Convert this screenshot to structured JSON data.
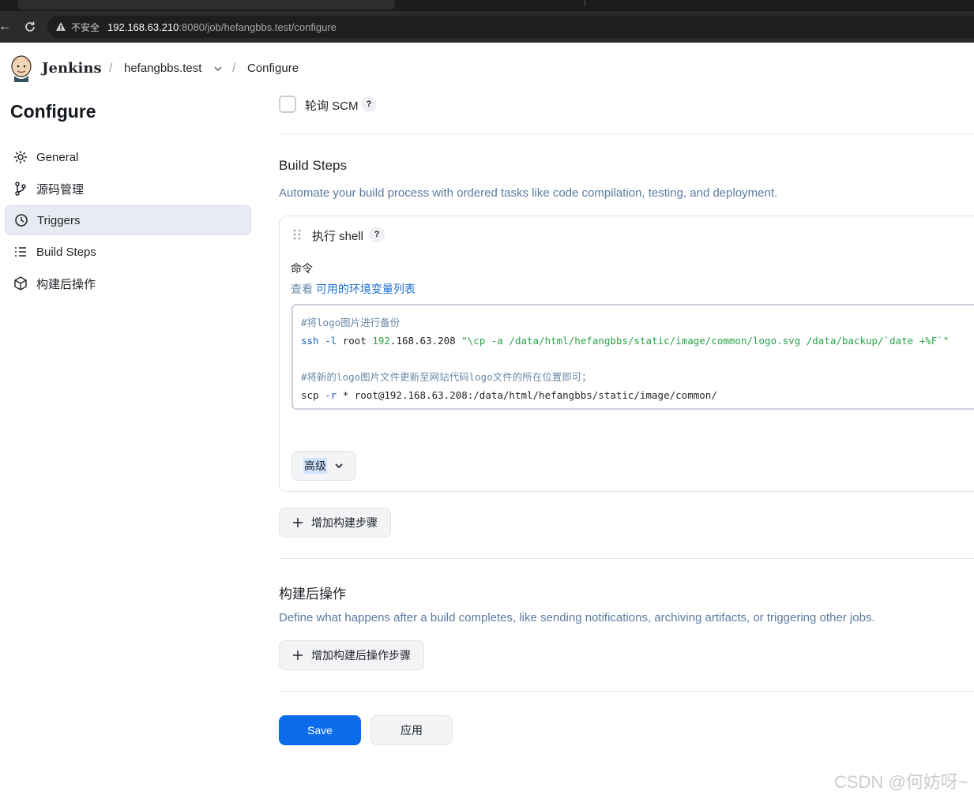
{
  "browser": {
    "insecure_label": "不安全",
    "url_host": "192.168.63.210",
    "url_path": ":8080/job/hefangbbs.test/configure"
  },
  "header": {
    "brand": "Jenkins",
    "breadcrumbs": [
      "hefangbbs.test",
      "Configure"
    ]
  },
  "sidebar": {
    "title": "Configure",
    "items": [
      {
        "label": "General",
        "icon": "gear-icon"
      },
      {
        "label": "源码管理",
        "icon": "git-branch-icon"
      },
      {
        "label": "Triggers",
        "icon": "clock-icon",
        "active": true
      },
      {
        "label": "Build Steps",
        "icon": "list-icon"
      },
      {
        "label": "构建后操作",
        "icon": "cube-icon"
      }
    ]
  },
  "triggers": {
    "poll_scm_label": "轮询 SCM",
    "poll_scm_checked": false
  },
  "build_steps": {
    "title": "Build Steps",
    "description": "Automate your build process with ordered tasks like code compilation, testing, and deployment.",
    "step": {
      "title": "执行 shell",
      "command_label": "命令",
      "env_prefix": "查看 ",
      "env_link": "可用的环境变量列表",
      "code": {
        "line1": "#将logo图片进行备份",
        "line2_cmd": "ssh",
        "line2_flag": "-l",
        "line2_user": "root",
        "line2_ip_a": "192",
        "line2_ip_b": ".168.63.208",
        "line2_str": "\"\\cp -a /data/html/hefangbbs/static/image/common/logo.svg /data/backup/`date +%F`\"",
        "line4": "#将新的logo图片文件更新至网站代码logo文件的所在位置即可；",
        "line5_cmd": "scp",
        "line5_flag": "-r",
        "line5_rest": "* root@192.168.63.208:/data/html/hefangbbs/static/image/common/"
      },
      "advanced_label": "高级"
    },
    "add_step_label": "增加构建步骤"
  },
  "post_build": {
    "title": "构建后操作",
    "description": "Define what happens after a build completes, like sending notifications, archiving artifacts, or triggering other jobs.",
    "add_label": "增加构建后操作步骤"
  },
  "actions": {
    "save_label": "Save",
    "apply_label": "应用"
  },
  "watermark": "CSDN @何妨呀~",
  "colors": {
    "primary": "#0b6bea",
    "link": "#1a6fd1",
    "description": "#5b7aa0",
    "active_nav": "#e8ecf2"
  }
}
